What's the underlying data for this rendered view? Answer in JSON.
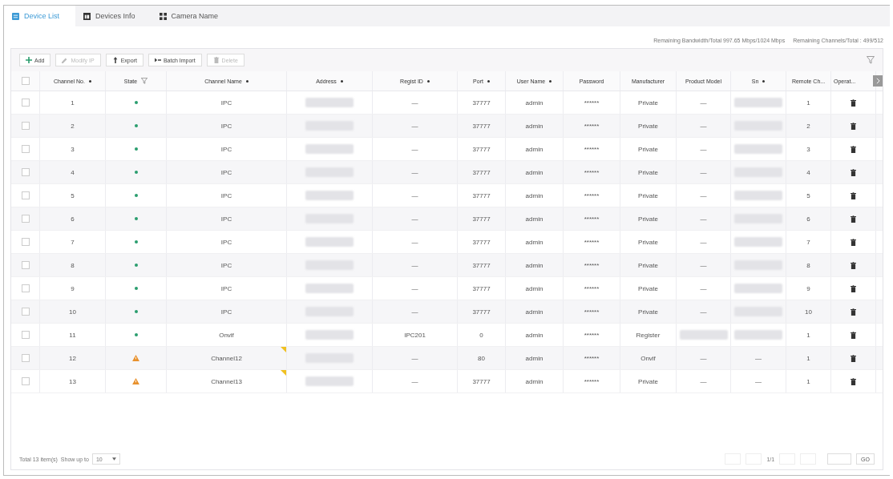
{
  "tabs": [
    {
      "label": "Device List",
      "selected": true
    },
    {
      "label": "Devices Info",
      "selected": false
    },
    {
      "label": "Camera Name",
      "selected": false
    }
  ],
  "summary": [
    "Remaining Bandwidth/Total 997.65 Mbps/1024 Mbps",
    "Remaining Channels/Total : 499/512"
  ],
  "toolbar": [
    {
      "label": "Add",
      "disabled": false
    },
    {
      "label": "Modify IP",
      "disabled": true
    },
    {
      "label": "Export",
      "disabled": false
    },
    {
      "label": "Batch Import",
      "disabled": false
    },
    {
      "label": "Delete",
      "disabled": true
    }
  ],
  "table": {
    "all_checked": false,
    "columns": [
      {
        "label": "Channel No.",
        "sortable": true
      },
      {
        "label": "State",
        "sortable": false
      },
      {
        "label": "Channel Name",
        "sortable": true
      },
      {
        "label": "Address",
        "sortable": true
      },
      {
        "label": "Regist ID",
        "sortable": true
      },
      {
        "label": "Port",
        "sortable": true
      },
      {
        "label": "User Name",
        "sortable": true
      },
      {
        "label": "Password",
        "sortable": false
      },
      {
        "label": "Manufacturer",
        "sortable": false
      },
      {
        "label": "Product Model",
        "sortable": false
      },
      {
        "label": "Sn",
        "sortable": true
      },
      {
        "label": "Remote Ch...",
        "sortable": false
      },
      {
        "label": "Operat...",
        "sortable": false
      }
    ],
    "rows": [
      {
        "checked": false,
        "no": "1",
        "kind": "online",
        "name": "IPC",
        "flagged": false,
        "regist_id": "—",
        "port": "37777",
        "user": "admin",
        "password": "******",
        "manufacturer": "Private",
        "product_model": "—",
        "remote": "1"
      },
      {
        "checked": false,
        "no": "2",
        "kind": "online",
        "name": "IPC",
        "flagged": false,
        "regist_id": "—",
        "port": "37777",
        "user": "admin",
        "password": "******",
        "manufacturer": "Private",
        "product_model": "—",
        "remote": "2"
      },
      {
        "checked": false,
        "no": "3",
        "kind": "online",
        "name": "IPC",
        "flagged": false,
        "regist_id": "—",
        "port": "37777",
        "user": "admin",
        "password": "******",
        "manufacturer": "Private",
        "product_model": "—",
        "remote": "3"
      },
      {
        "checked": false,
        "no": "4",
        "kind": "online",
        "name": "IPC",
        "flagged": false,
        "regist_id": "—",
        "port": "37777",
        "user": "admin",
        "password": "******",
        "manufacturer": "Private",
        "product_model": "—",
        "remote": "4"
      },
      {
        "checked": false,
        "no": "5",
        "kind": "online",
        "name": "IPC",
        "flagged": false,
        "regist_id": "—",
        "port": "37777",
        "user": "admin",
        "password": "******",
        "manufacturer": "Private",
        "product_model": "—",
        "remote": "5"
      },
      {
        "checked": false,
        "no": "6",
        "kind": "online",
        "name": "IPC",
        "flagged": false,
        "regist_id": "—",
        "port": "37777",
        "user": "admin",
        "password": "******",
        "manufacturer": "Private",
        "product_model": "—",
        "remote": "6"
      },
      {
        "checked": false,
        "no": "7",
        "kind": "online",
        "name": "IPC",
        "flagged": false,
        "regist_id": "—",
        "port": "37777",
        "user": "admin",
        "password": "******",
        "manufacturer": "Private",
        "product_model": "—",
        "remote": "7"
      },
      {
        "checked": false,
        "no": "8",
        "kind": "online",
        "name": "IPC",
        "flagged": false,
        "regist_id": "—",
        "port": "37777",
        "user": "admin",
        "password": "******",
        "manufacturer": "Private",
        "product_model": "—",
        "remote": "8"
      },
      {
        "checked": false,
        "no": "9",
        "kind": "online",
        "name": "IPC",
        "flagged": false,
        "regist_id": "—",
        "port": "37777",
        "user": "admin",
        "password": "******",
        "manufacturer": "Private",
        "product_model": "—",
        "remote": "9"
      },
      {
        "checked": false,
        "no": "10",
        "kind": "online",
        "name": "IPC",
        "flagged": false,
        "regist_id": "—",
        "port": "37777",
        "user": "admin",
        "password": "******",
        "manufacturer": "Private",
        "product_model": "—",
        "remote": "10"
      },
      {
        "checked": false,
        "no": "11",
        "kind": "online",
        "name": "Onvif",
        "flagged": false,
        "regist_id": "IPC201",
        "port": "0",
        "user": "admin",
        "password": "******",
        "manufacturer": "Register",
        "remote": "1"
      },
      {
        "checked": false,
        "no": "12",
        "kind": "warning",
        "name": "Channel12",
        "flagged": true,
        "regist_id": "—",
        "port": "80",
        "user": "admin",
        "password": "******",
        "manufacturer": "Onvif",
        "product_model": "—",
        "sn": "—",
        "remote": "1"
      },
      {
        "checked": false,
        "no": "13",
        "kind": "warning",
        "name": "Channel13",
        "flagged": true,
        "regist_id": "—",
        "port": "37777",
        "user": "admin",
        "password": "******",
        "manufacturer": "Private",
        "product_model": "—",
        "sn": "—",
        "remote": "1"
      }
    ]
  },
  "footer": {
    "total": "Total 13 item(s)",
    "show_label": "Show up to",
    "page_size": "10",
    "page": "1/1",
    "go": "GO"
  }
}
